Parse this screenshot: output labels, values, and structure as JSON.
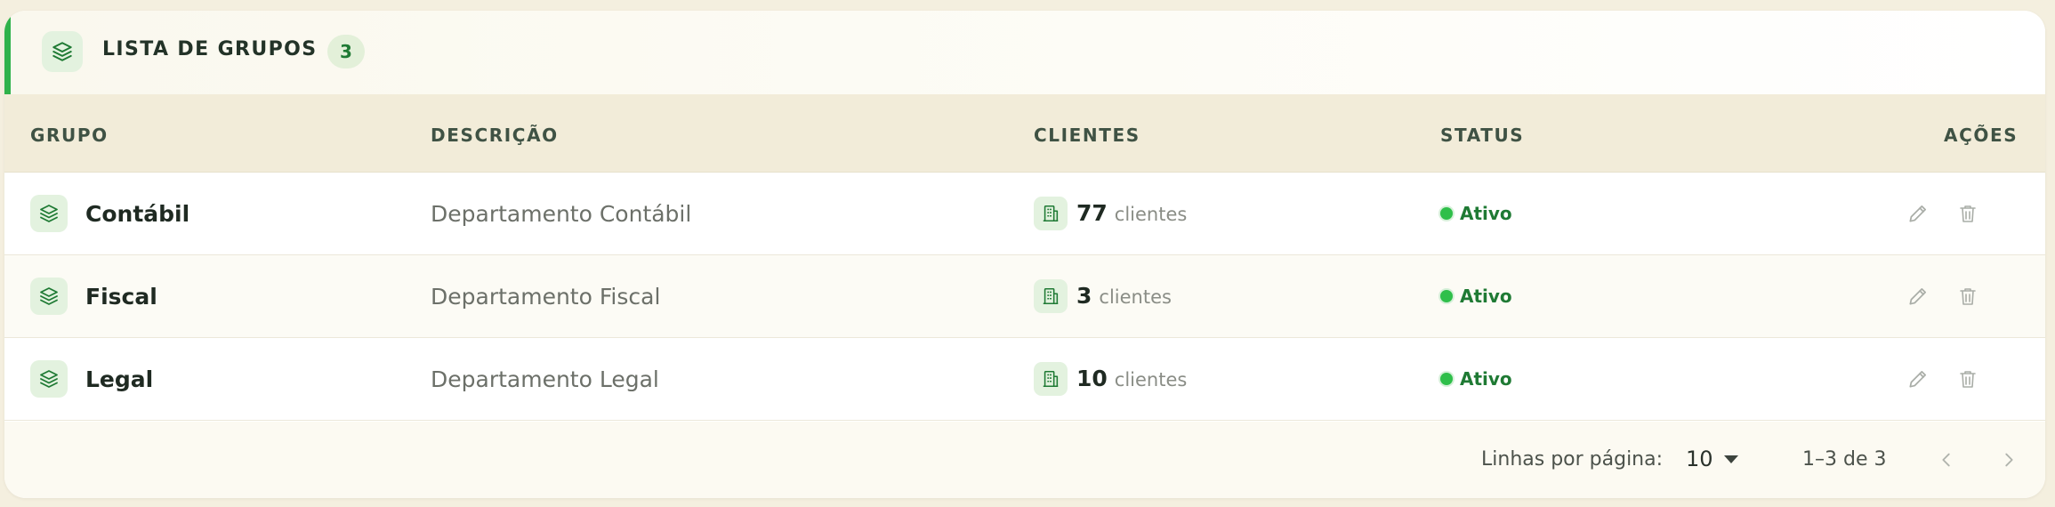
{
  "header": {
    "title": "LISTA DE GRUPOS",
    "count": "3",
    "icon": "layers-icon"
  },
  "columns": {
    "grupo": "GRUPO",
    "descricao": "DESCRIÇÃO",
    "clientes": "CLIENTES",
    "status": "STATUS",
    "acoes": "AÇÕES"
  },
  "rows": [
    {
      "name": "Contábil",
      "description": "Departamento Contábil",
      "clients": "77",
      "clients_label": "clientes",
      "status": "Ativo"
    },
    {
      "name": "Fiscal",
      "description": "Departamento Fiscal",
      "clients": "3",
      "clients_label": "clientes",
      "status": "Ativo"
    },
    {
      "name": "Legal",
      "description": "Departamento Legal",
      "clients": "10",
      "clients_label": "clientes",
      "status": "Ativo"
    }
  ],
  "footer": {
    "rows_per_page_label": "Linhas por página:",
    "rows_per_page_value": "10",
    "range": "1–3 de 3"
  },
  "colors": {
    "accent": "#2fb24a",
    "status_active": "#1f7a34",
    "header_bg": "#f2ecd9"
  }
}
